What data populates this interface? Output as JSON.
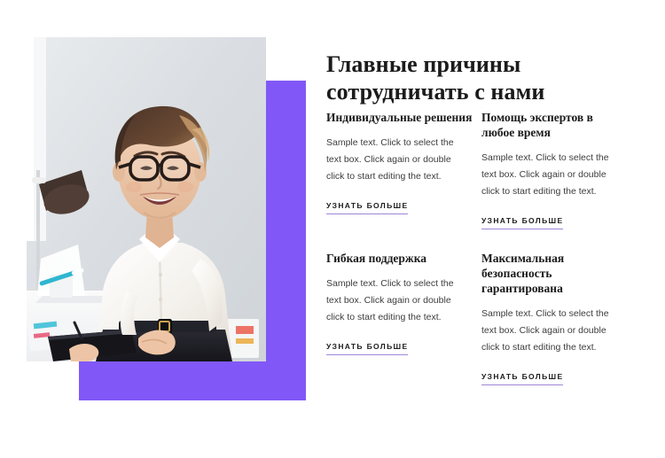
{
  "theme": {
    "accent_color": "#8158f7",
    "underline_color": "#9f86d8",
    "heading_color": "#1b1b1b",
    "body_color": "#3d3d3d",
    "background": "#ffffff"
  },
  "visual": {
    "accent_block_name": "purple-accent-block",
    "photo_alt": "Smiling businesswoman with glasses holding a folder in a bright office"
  },
  "content": {
    "headline": "Главные причины сотрудничать с нами",
    "features": [
      {
        "title": "Индивидуальные решения",
        "body": "Sample text. Click to select the text box. Click again or double click to start editing the text.",
        "link": "УЗНАТЬ БОЛЬШЕ"
      },
      {
        "title": "Помощь экспертов в любое время",
        "body": "Sample text. Click to select the text box. Click again or double click to start editing the text.",
        "link": "УЗНАТЬ БОЛЬШЕ"
      },
      {
        "title": "Гибкая поддержка",
        "body": "Sample text. Click to select the text box. Click again or double click to start editing the text.",
        "link": "УЗНАТЬ БОЛЬШЕ"
      },
      {
        "title": "Максимальная безопасность гарантирована",
        "body": "Sample text. Click to select the text box. Click again or double click to start editing the text.",
        "link": "УЗНАТЬ БОЛЬШЕ"
      }
    ]
  }
}
